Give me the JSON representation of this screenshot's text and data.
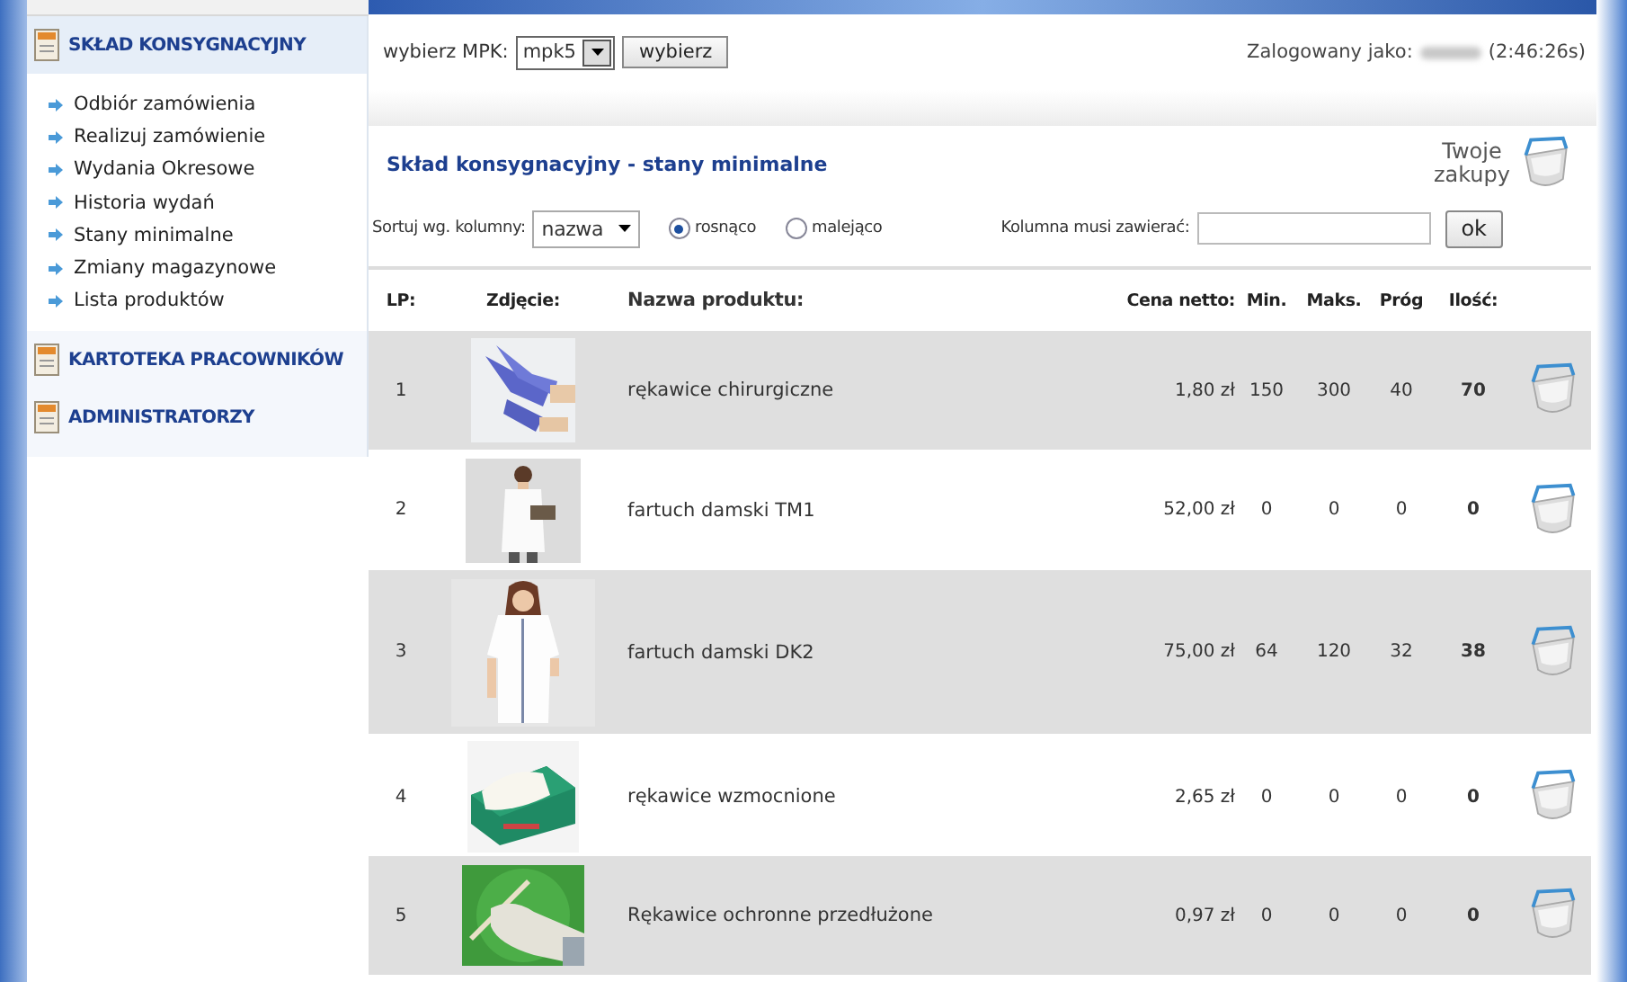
{
  "sidebar": {
    "sections": [
      {
        "title": "SKŁAD KONSYGNACYJNY",
        "expanded": true,
        "items": [
          "Odbiór zamówienia",
          "Realizuj zamówienie",
          "Wydania Okresowe",
          "Historia wydań",
          "Stany minimalne",
          "Zmiany magazynowe",
          "Lista produktów"
        ]
      },
      {
        "title": "KARTOTEKA PRACOWNIKÓW",
        "expanded": false
      },
      {
        "title": "ADMINISTRATORZY",
        "expanded": false
      }
    ]
  },
  "topbar": {
    "mpk_label": "wybierz MPK:",
    "mpk_value": "mpk5",
    "choose_button": "wybierz",
    "login_label": "Zalogowany jako:",
    "session_time": "(2:46:26s)"
  },
  "page_title": "Skład konsygnacyjny - stany minimalne",
  "cart_link": {
    "line1": "Twoje",
    "line2": "zakupy"
  },
  "sort": {
    "label": "Sortuj wg. kolumny:",
    "value": "nazwa",
    "options": [
      {
        "label": "rosnąco",
        "selected": true
      },
      {
        "label": "malejąco",
        "selected": false
      }
    ],
    "filter_label": "Kolumna musi zawierać:",
    "ok_button": "ok"
  },
  "table": {
    "columns": [
      "LP:",
      "Zdjęcie:",
      "Nazwa produktu:",
      "Cena netto:",
      "Min.",
      "Maks.",
      "Próg",
      "Ilość:"
    ],
    "rows": [
      {
        "lp": "1",
        "name": "rękawice chirurgiczne",
        "price": "1,80 zł",
        "min": "150",
        "max": "300",
        "threshold": "40",
        "qty": "70"
      },
      {
        "lp": "2",
        "name": "fartuch damski TM1",
        "price": "52,00 zł",
        "min": "0",
        "max": "0",
        "threshold": "0",
        "qty": "0"
      },
      {
        "lp": "3",
        "name": "fartuch damski DK2",
        "price": "75,00 zł",
        "min": "64",
        "max": "120",
        "threshold": "32",
        "qty": "38"
      },
      {
        "lp": "4",
        "name": "rękawice wzmocnione",
        "price": "2,65 zł",
        "min": "0",
        "max": "0",
        "threshold": "0",
        "qty": "0"
      },
      {
        "lp": "5",
        "name": "Rękawice ochronne przedłużone",
        "price": "0,97 zł",
        "min": "0",
        "max": "0",
        "threshold": "0",
        "qty": "0"
      }
    ]
  }
}
